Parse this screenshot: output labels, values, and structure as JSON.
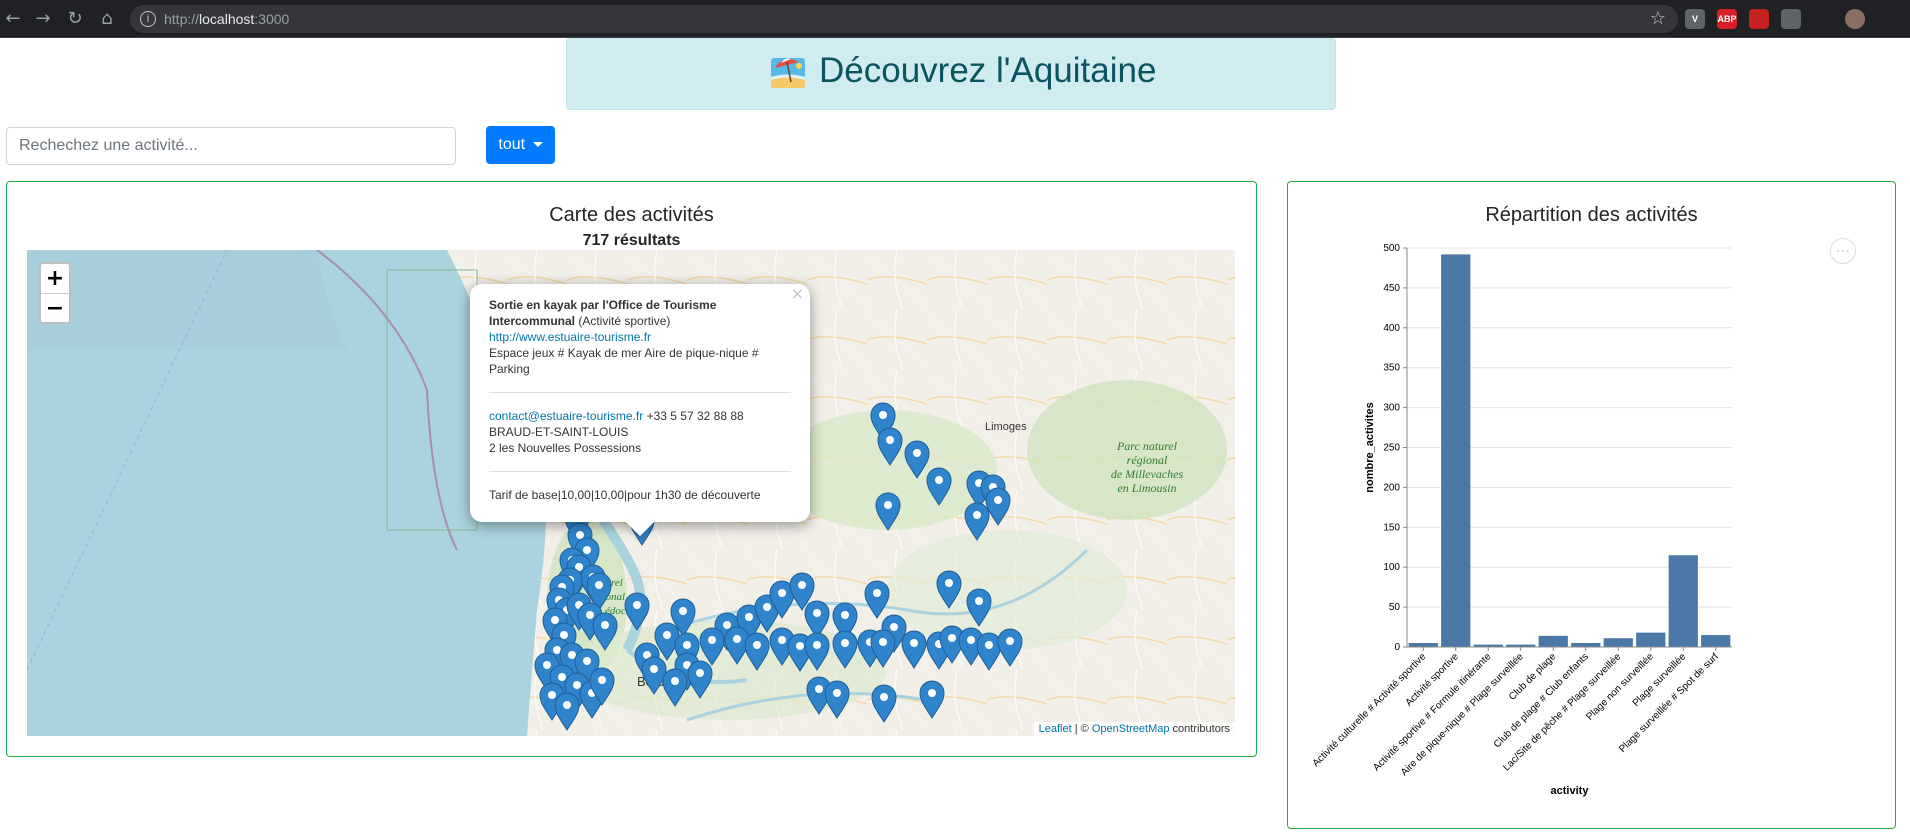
{
  "browser": {
    "url_prefix": "http://",
    "url_host": "localhost",
    "url_suffix": ":3000",
    "extensions": [
      {
        "name": "vue-devtools-icon",
        "label": "V",
        "color": "#5f6368"
      },
      {
        "name": "adblock-icon",
        "label": "ABP",
        "color": "#d81f26"
      },
      {
        "name": "extension-red-icon",
        "label": "",
        "color": "#c5221f"
      },
      {
        "name": "extension-gray-icon",
        "label": "",
        "color": "#5f6368"
      },
      {
        "name": "puzzle-icon",
        "label": "",
        "color": "#202124"
      },
      {
        "name": "profile-avatar",
        "label": "",
        "color": "#8d6e63"
      }
    ]
  },
  "header": {
    "title": "Découvrez l'Aquitaine"
  },
  "search": {
    "placeholder": "Rechechez une activité..."
  },
  "filter": {
    "label": "tout"
  },
  "map_card": {
    "title": "Carte des activités",
    "results": "717 résultats",
    "zoom_in": "+",
    "zoom_out": "−",
    "attribution": {
      "leaflet": "Leaflet",
      "sep": " | © ",
      "osm": "OpenStreetMap",
      "tail": " contributors"
    },
    "labels": {
      "limoges": "Limoges",
      "bordeaux": "Bordea",
      "parc_limousin_1": "Parc naturel",
      "parc_limousin_2": "régional",
      "parc_limousin_3": "de Millevaches",
      "parc_limousin_4": "en Limousin",
      "parc_medoc_1": "aturel",
      "parc_medoc_2": "gional",
      "parc_medoc_3": "édoc"
    },
    "popup": {
      "title_bold": "Sortie en kayak par l'Office de Tourisme Intercommunal",
      "title_type": " (Activité sportive)",
      "website": "http://www.estuaire-tourisme.fr",
      "features": "Espace jeux # Kayak de mer Aire de pique-nique # Parking",
      "email": "contact@estuaire-tourisme.fr",
      "phone": " +33 5 57 32 88 88",
      "city": "BRAUD-ET-SAINT-LOUIS",
      "address": "2 les Nouvelles Possessions",
      "price": "Tarif de base|10,00|10,00|pour 1h30 de découverte"
    }
  },
  "chart_card": {
    "title": "Répartition des activités"
  },
  "chart_data": {
    "type": "bar",
    "xlabel": "activity",
    "ylabel": "nombre_activites",
    "ylim": [
      0,
      500
    ],
    "yticks": [
      0,
      50,
      100,
      150,
      200,
      250,
      300,
      350,
      400,
      450,
      500
    ],
    "color": "#4c78a8",
    "grid": true,
    "categories": [
      "Activité culturelle # Activité sportive",
      "Activité sportive",
      "Activité sportive # Formule itinérante",
      "Aire de pique-nique # Plage surveillée",
      "Club de plage",
      "Club de plage # Club enfants",
      "Lac/Site de pêche # Plage surveillée",
      "Plage non surveillée",
      "Plage surveillée",
      "Plage surveillée # Spot de surf"
    ],
    "values": [
      5,
      492,
      3,
      3,
      14,
      5,
      11,
      18,
      115,
      15
    ]
  }
}
